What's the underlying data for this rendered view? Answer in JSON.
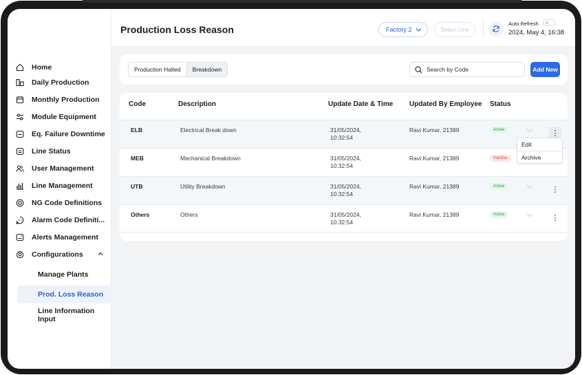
{
  "header": {
    "title": "Production Loss Reason",
    "factory": "Factory 2",
    "line_placeholder": "Select Line",
    "auto_refresh_label": "Auto Refresh",
    "datetime": "2024, May 4, 16:38"
  },
  "sidebar": {
    "items": [
      {
        "label": "Home",
        "icon": "home-icon"
      },
      {
        "label": "Daily Production",
        "icon": "daily-production-icon"
      },
      {
        "label": "Monthly Production",
        "icon": "calendar-icon"
      },
      {
        "label": "Module Equipment",
        "icon": "equipment-icon"
      },
      {
        "label": "Eq. Failure Downtime",
        "icon": "downtime-icon"
      },
      {
        "label": "Line Status",
        "icon": "line-status-icon"
      },
      {
        "label": "User Management",
        "icon": "users-icon"
      },
      {
        "label": "Line Management",
        "icon": "bar-chart-icon"
      },
      {
        "label": "NG Code Definitions",
        "icon": "ng-code-icon"
      },
      {
        "label": "Alarm Code Definiti...",
        "icon": "alarm-icon"
      },
      {
        "label": "Alerts Management",
        "icon": "alert-icon"
      },
      {
        "label": "Configurations",
        "icon": "gear-icon"
      }
    ],
    "sub_items": [
      {
        "label": "Manage Plants"
      },
      {
        "label": "Prod. Loss Reason"
      },
      {
        "label": "Line Information Input"
      }
    ]
  },
  "filters": {
    "tabs": [
      "Production Halted",
      "Breakdown"
    ],
    "search_placeholder": "Search by Code",
    "add_label": "Add New"
  },
  "table": {
    "columns": [
      "Code",
      "Description",
      "Update Date & Time",
      "Updated By Employee",
      "Status"
    ],
    "rows": [
      {
        "code": "ELB",
        "description": "Electrical Break down",
        "date": "31/05/2024,",
        "time": "10:32:54",
        "employee": "Ravi Kumar, 21389",
        "status": "Active"
      },
      {
        "code": "MEB",
        "description": "Mechanical Breakdown",
        "date": "31/05/2024,",
        "time": "10:32:54",
        "employee": "Ravi Kumar, 21389",
        "status": "Inactive"
      },
      {
        "code": "UTB",
        "description": "Utility Breakdown",
        "date": "31/05/2024,",
        "time": "10:32:54",
        "employee": "Ravi Kumar, 21389",
        "status": "Active"
      },
      {
        "code": "Others",
        "description": "Others",
        "date": "31/05/2024,",
        "time": "10:32:54",
        "employee": "Ravi Kumar, 21389",
        "status": "Active"
      }
    ]
  },
  "row_menu": {
    "edit": "Edit",
    "archive": "Archive"
  },
  "colors": {
    "accent": "#2b6be8",
    "active_text": "#27a046",
    "inactive_text": "#e0463c"
  }
}
